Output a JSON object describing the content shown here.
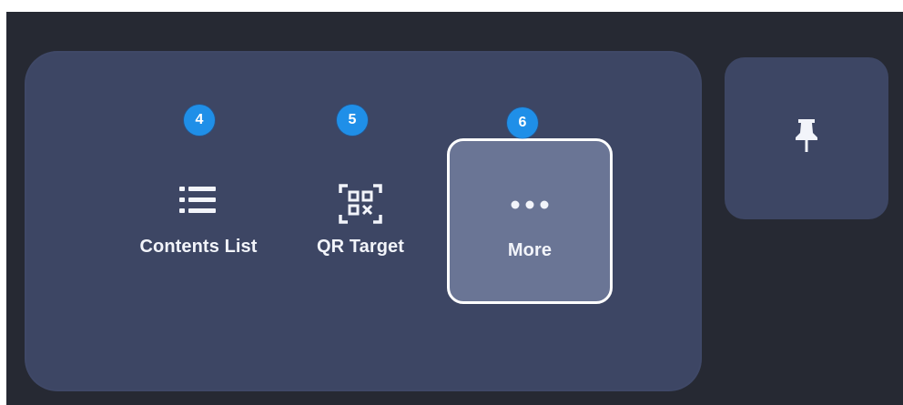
{
  "toolbar": {
    "items": [
      {
        "label": "Contents List",
        "icon": "list-icon",
        "badge": "4",
        "selected": false
      },
      {
        "label": "QR Target",
        "icon": "qr-scan-icon",
        "badge": "5",
        "selected": false
      },
      {
        "label": "More",
        "icon": "more-dots-icon",
        "badge": "6",
        "selected": true
      }
    ],
    "pin": {
      "icon": "pin-icon"
    }
  },
  "colors": {
    "background": "#262933",
    "panel": "#3d4664",
    "selected_tile": "#6a7595",
    "badge": "#1f8fe8",
    "text": "#f2f4fa"
  }
}
